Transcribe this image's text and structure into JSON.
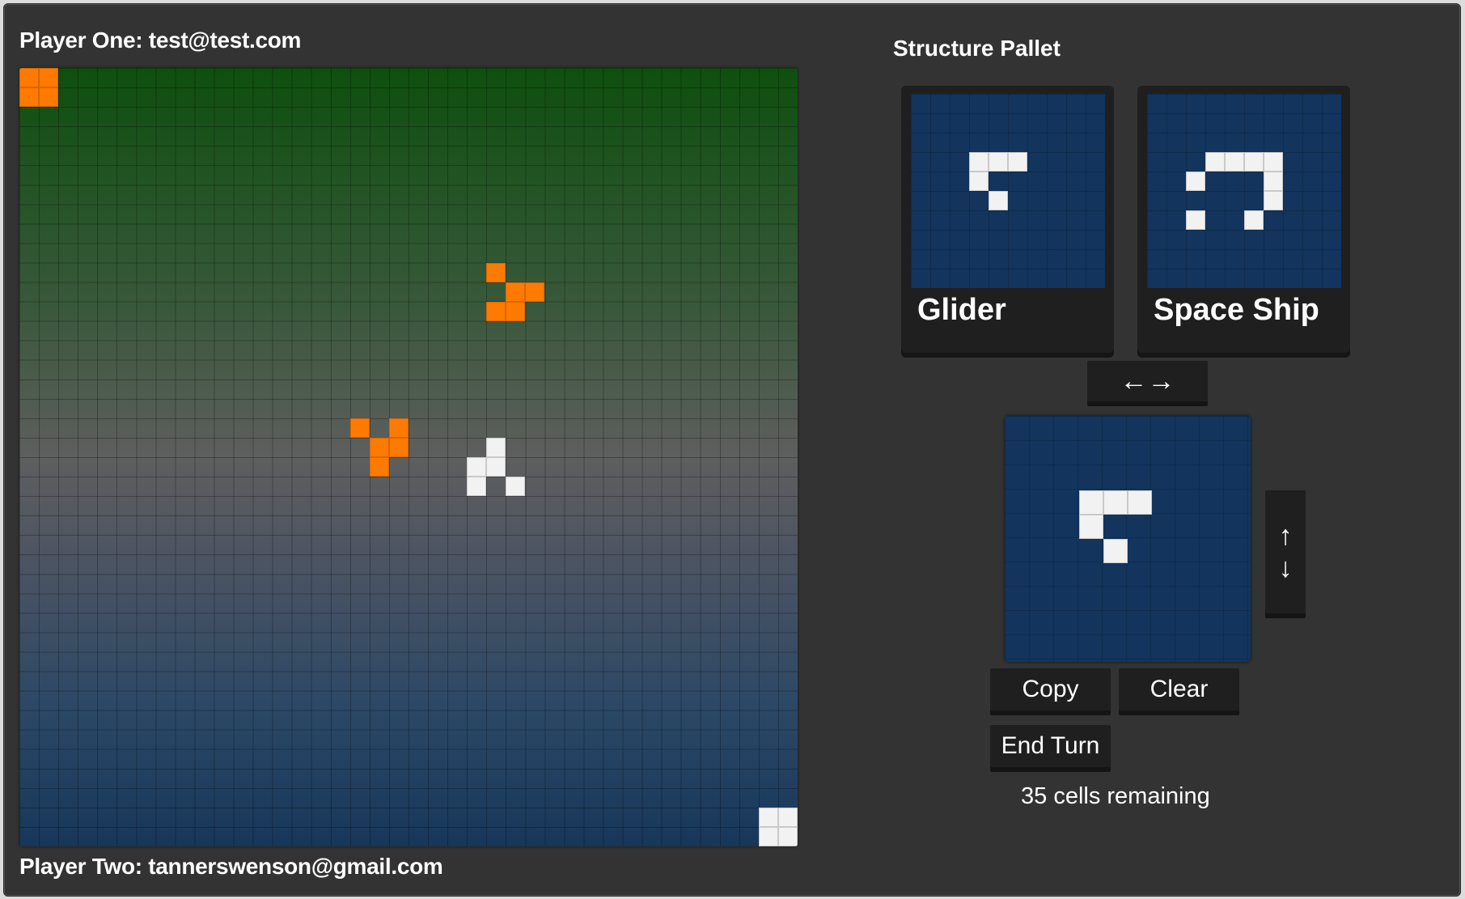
{
  "players": {
    "one_label": "Player One: test@test.com",
    "two_label": "Player Two: tannerswenson@gmail.com"
  },
  "colors": {
    "player_one_cells": "#ff7a00",
    "player_two_cells": "#f2f2f2",
    "panel_background": "#333333",
    "preview_background": "#12345d"
  },
  "board": {
    "grid_size": 40,
    "orange_cells": [
      [
        0,
        0
      ],
      [
        1,
        0
      ],
      [
        0,
        1
      ],
      [
        1,
        1
      ],
      [
        24,
        10
      ],
      [
        25,
        11
      ],
      [
        26,
        11
      ],
      [
        24,
        12
      ],
      [
        25,
        12
      ],
      [
        17,
        18
      ],
      [
        19,
        18
      ],
      [
        18,
        19
      ],
      [
        19,
        19
      ],
      [
        18,
        20
      ]
    ],
    "white_cells": [
      [
        24,
        19
      ],
      [
        23,
        20
      ],
      [
        24,
        20
      ],
      [
        23,
        21
      ],
      [
        25,
        21
      ],
      [
        38,
        38
      ],
      [
        39,
        38
      ],
      [
        38,
        39
      ],
      [
        39,
        39
      ]
    ]
  },
  "pallet": {
    "title": "Structure Pallet",
    "items": [
      {
        "name": "Glider",
        "grid_size": 10,
        "cells": [
          [
            3,
            3
          ],
          [
            4,
            3
          ],
          [
            5,
            3
          ],
          [
            3,
            4
          ],
          [
            4,
            5
          ]
        ]
      },
      {
        "name": "Space Ship",
        "grid_size": 10,
        "cells": [
          [
            3,
            3
          ],
          [
            4,
            3
          ],
          [
            5,
            3
          ],
          [
            6,
            3
          ],
          [
            2,
            4
          ],
          [
            6,
            4
          ],
          [
            6,
            5
          ],
          [
            2,
            6
          ],
          [
            5,
            6
          ]
        ]
      }
    ]
  },
  "editor": {
    "grid_size": 10,
    "cells": [
      [
        3,
        3
      ],
      [
        4,
        3
      ],
      [
        5,
        3
      ],
      [
        3,
        4
      ],
      [
        4,
        5
      ]
    ]
  },
  "controls": {
    "flip_horizontal_label": "←→",
    "flip_vertical_up": "↑",
    "flip_vertical_down": "↓",
    "copy_label": "Copy",
    "clear_label": "Clear",
    "end_turn_label": "End Turn"
  },
  "status": {
    "remaining_text": "35 cells remaining"
  }
}
